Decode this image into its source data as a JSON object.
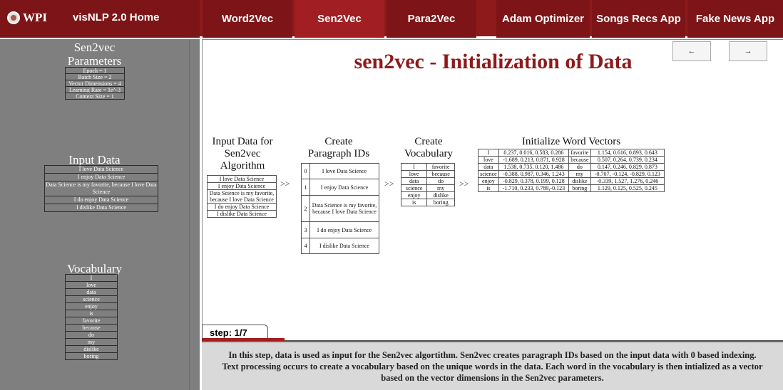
{
  "nav": {
    "logo_text": "WPI",
    "home": "visNLP 2.0 Home",
    "tabs": [
      {
        "label": "Word2Vec",
        "active": false
      },
      {
        "label": "Sen2Vec",
        "active": true
      },
      {
        "label": "Para2Vec",
        "active": false
      },
      {
        "label": "Adam Optimizer",
        "active": false
      },
      {
        "label": "Songs Recs App",
        "active": false
      },
      {
        "label": "Fake News App",
        "active": false
      }
    ]
  },
  "sidebar": {
    "params_title_line1": "Sen2vec",
    "params_title_line2": "Parameters",
    "params": [
      "Epoch = 1",
      "Batch Size = 2",
      "Vector Dimensions = 4",
      "Learning Rate = 1e^-3",
      "Context Size = 1"
    ],
    "input_title": "Input Data",
    "inputs": [
      "I love Data Science",
      "I enjoy Data Science",
      "Data Science is my favorite, because I love Data Science",
      "I do enjoy Data Science",
      "I dislike Data Science"
    ],
    "vocab_title": "Vocabulary",
    "vocab": [
      "I",
      "love",
      "data",
      "science",
      "enjoy",
      "is",
      "favorite",
      "because",
      "do",
      "my",
      "dislike",
      "boring"
    ]
  },
  "main": {
    "title": "sen2vec - Initialization of Data",
    "prev": "←",
    "next": "→",
    "col1_title_l1": "Input Data for",
    "col1_title_l2": "Sen2vec",
    "col1_title_l3": "Algorithm",
    "col1_rows": [
      "I love Data Science",
      "I enjoy Data Science",
      "Data Science is my favorite, because I love Data Science",
      "I do enjoy Data Science",
      "I dislike Data Science"
    ],
    "col2_title_l1": "Create",
    "col2_title_l2": "Paragraph IDs",
    "col2_rows": [
      {
        "id": "0",
        "text": "I love Data Science"
      },
      {
        "id": "1",
        "text": "I enjoy Data Science"
      },
      {
        "id": "2",
        "text": "Data Science is my favorite, because I love Data Science"
      },
      {
        "id": "3",
        "text": "I do enjoy Data Science"
      },
      {
        "id": "4",
        "text": "I dislike Data Science"
      }
    ],
    "col3_title_l1": "Create",
    "col3_title_l2": "Vocabulary",
    "col3_rows": [
      [
        "I",
        "favorite"
      ],
      [
        "love",
        "because"
      ],
      [
        "data",
        "do"
      ],
      [
        "science",
        "my"
      ],
      [
        "enjoy",
        "dislike"
      ],
      [
        "is",
        "boring"
      ]
    ],
    "col4_title": "Initialize Word Vectors",
    "col4_rows": [
      [
        "I",
        "0.237, 0.016, 0.583, 0.286",
        "favorite",
        "1.154, 0.616, 0.893, 0.643"
      ],
      [
        "love",
        "-1.689, 0.213, 0.871, 0.928",
        "because",
        "0.507, 0.264, 0.739, 0.234"
      ],
      [
        "data",
        "1.538, 0.735, 0.120, 1.486",
        "do",
        "0.147, 0.246, 0.829, 0.873"
      ],
      [
        "science",
        "-0.388, 0.987, 0.346, 1.243",
        "my",
        "-0.707, -0.124, -0.829, 0.123"
      ],
      [
        "enjoy",
        "-0.829, 0.378, 0.199, 0.128",
        "dislike",
        "-0.339, 1.527, 1.276, 0.246"
      ],
      [
        "is",
        "-1.710, 0.233, 0.789,-0.123",
        "boring",
        "1.129, 0.125, 0.525, 0.245"
      ]
    ],
    "arrow": ">>",
    "step_label": "step: 1/7",
    "progress_fraction": 0.142857,
    "description_l1": "In this step, data is used as input for the Sen2vec algortithm. Sen2vec creates paragraph IDs based on the input data with 0 based indexing.",
    "description_l2": "Text processing occurs to create a vocabulary based on the unique words in the data. Each word in the vocabulary is then intialized as a vector",
    "description_l3": "based on the vector dimensions in the Sen2vec parameters."
  },
  "colors": {
    "brand": "#8e1a1c",
    "active_tab": "#a11f22",
    "sidebar": "#7f7f7f"
  }
}
